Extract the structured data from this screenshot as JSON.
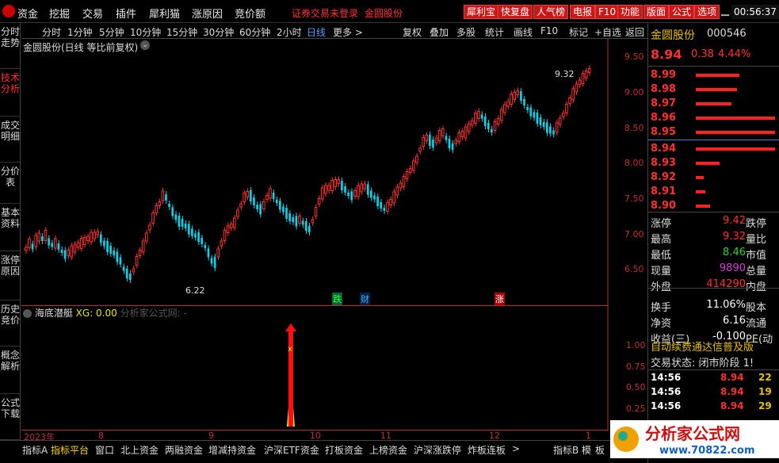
{
  "menu": {
    "items": [
      "资金",
      "挖掘",
      "交易",
      "插件",
      "犀利猫",
      "涨原因",
      "竞价额"
    ],
    "warning": "证券交易未登录",
    "stock_name": "金圆股份",
    "toolbar": [
      "犀利宝",
      "快复盘",
      "人气榜",
      "电报",
      "F10",
      "功能",
      "版面",
      "公式",
      "选项"
    ],
    "time": "00:56:37"
  },
  "left_tabs": [
    "分时走势",
    "技术分析",
    "成交明细",
    "分价表",
    "基本资料",
    "涨停原因",
    "历史竞价",
    "概念解析",
    "公式下载"
  ],
  "top_tabs": [
    "分时",
    "1分钟",
    "5分钟",
    "10分钟",
    "15分钟",
    "30分钟",
    "60分钟",
    "2小时",
    "日线",
    "更多 >",
    "复权",
    "叠加",
    "多股",
    "统计",
    "画线",
    "F10",
    "标记",
    "+自选",
    "返回"
  ],
  "chart": {
    "title": "金圆股份(日线 等比前复权)",
    "high_label": "9.32",
    "low_label": "6.22",
    "markers": [
      "跌",
      "财",
      "涨"
    ],
    "yticks": [
      "9.50",
      "9.00",
      "8.50",
      "8.00",
      "7.50",
      "7.00",
      "6.50"
    ]
  },
  "indicator": {
    "name": "海底潜艇",
    "xg": "XG: 0.00",
    "source": "分析家公式网: -",
    "yticks": [
      "1.00",
      "0.75",
      "0.50",
      "0.25"
    ]
  },
  "xaxis": [
    "2023年",
    "8",
    "9",
    "10",
    "11",
    "12",
    "1"
  ],
  "bottom_tabs": [
    "指标A",
    "指标平台",
    "窗口",
    "北上资金",
    "两融资金",
    "增减持资金",
    "沪深ETF资金",
    "打板资金",
    "上榜资金",
    "沪深涨跌停",
    "炸板连板",
    ">",
    "指标B",
    "模",
    "板"
  ],
  "quote": {
    "name": "金圆股份",
    "code": "000546",
    "price": "8.94",
    "change": "0.38",
    "pct": "4.44%"
  },
  "order_book": {
    "asks": [
      {
        "p": "8.99",
        "w": 0.55
      },
      {
        "p": "8.98",
        "w": 0.52
      },
      {
        "p": "8.97",
        "w": 0.45
      },
      {
        "p": "8.96",
        "w": 1.0
      },
      {
        "p": "8.95",
        "w": 1.0
      }
    ],
    "bids": [
      {
        "p": "8.94",
        "w": 1.0
      },
      {
        "p": "8.93",
        "w": 0.3
      },
      {
        "p": "8.92",
        "w": 0.1
      },
      {
        "p": "8.91",
        "w": 0.12
      },
      {
        "p": "8.90",
        "w": 0.18
      }
    ]
  },
  "stats": [
    {
      "k": "涨停",
      "v": "9.42",
      "k2": "跌停",
      "c": "#ff3030"
    },
    {
      "k": "最高",
      "v": "9.32",
      "k2": "量比",
      "c": "#ff3030"
    },
    {
      "k": "最低",
      "v": "8.46",
      "k2": "市值",
      "c": "#30d030"
    },
    {
      "k": "现量",
      "v": "9890",
      "k2": "总量",
      "c": "#d040d0"
    },
    {
      "k": "外盘",
      "v": "414290",
      "k2": "内盘",
      "c": "#ff3030"
    },
    {
      "k": "换手",
      "v": "11.06%",
      "k2": "股本",
      "c": "#ffffff"
    },
    {
      "k": "净资",
      "v": "6.16",
      "k2": "流通",
      "c": "#ffffff"
    },
    {
      "k": "收益(三)",
      "v": "-0.100",
      "k2": "PE(动",
      "c": "#ffffff"
    }
  ],
  "notice": "自动续费通达信普及版",
  "trade_status": "交易状态: 闭市阶段 1!",
  "ticks": [
    {
      "t": "14:56",
      "p": "8.94",
      "v": "22"
    },
    {
      "t": "14:56",
      "p": "8.94",
      "v": "19"
    },
    {
      "t": "14:56",
      "p": "8.94",
      "v": "29"
    }
  ],
  "watermark": {
    "title": "分析家公式网",
    "url": "www.70822.com"
  }
}
